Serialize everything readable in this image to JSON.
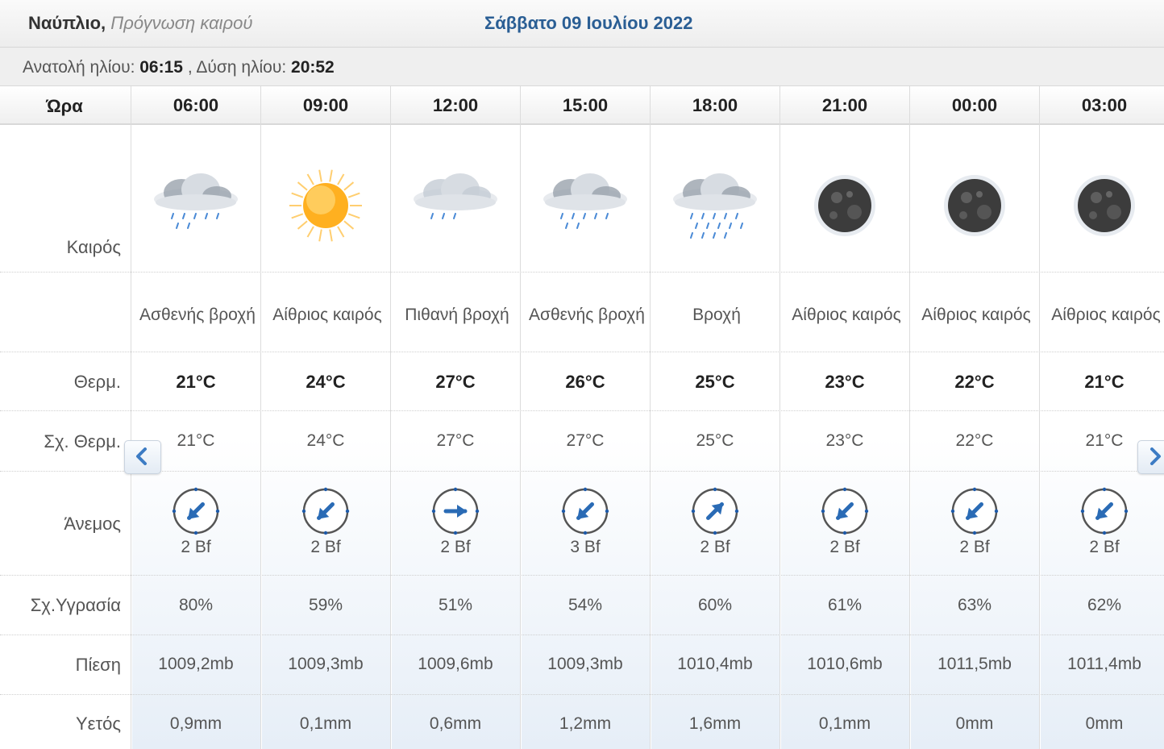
{
  "header": {
    "city": "Ναύπλιο,",
    "subtitle": "Πρόγνωση καιρού",
    "date": "Σάββατο 09 Ιουλίου 2022"
  },
  "sun": {
    "sunrise_label": "Ανατολή ηλίου:",
    "sunrise": "06:15",
    "sep": ",",
    "sunset_label": "Δύση ηλίου:",
    "sunset": "20:52"
  },
  "rows": {
    "time": "Ώρα",
    "weather": "Καιρός",
    "temp": "Θερμ.",
    "feels": "Σχ. Θερμ.",
    "wind": "Άνεμος",
    "humidity": "Σχ.Υγρασία",
    "pressure": "Πίεση",
    "rain": "Υετός"
  },
  "columns": [
    {
      "time": "06:00",
      "icon": "light-rain-icon",
      "desc": "Ασθενής βροχή",
      "temp": "21°C",
      "feels": "21°C",
      "wind_bf": "2 Bf",
      "wind_dir": "nw",
      "humidity": "80%",
      "pressure": "1009,2mb",
      "rain": "0,9mm"
    },
    {
      "time": "09:00",
      "icon": "sun-icon",
      "desc": "Αίθριος καιρός",
      "temp": "24°C",
      "feels": "24°C",
      "wind_bf": "2 Bf",
      "wind_dir": "nw",
      "humidity": "59%",
      "pressure": "1009,3mb",
      "rain": "0,1mm"
    },
    {
      "time": "12:00",
      "icon": "possible-rain-icon",
      "desc": "Πιθανή βροχή",
      "temp": "27°C",
      "feels": "27°C",
      "wind_bf": "2 Bf",
      "wind_dir": "e",
      "humidity": "51%",
      "pressure": "1009,6mb",
      "rain": "0,6mm"
    },
    {
      "time": "15:00",
      "icon": "light-rain-icon",
      "desc": "Ασθενής βροχή",
      "temp": "26°C",
      "feels": "27°C",
      "wind_bf": "3 Bf",
      "wind_dir": "nw",
      "humidity": "54%",
      "pressure": "1009,3mb",
      "rain": "1,2mm"
    },
    {
      "time": "18:00",
      "icon": "rain-icon",
      "desc": "Βροχή",
      "temp": "25°C",
      "feels": "25°C",
      "wind_bf": "2 Bf",
      "wind_dir": "se",
      "humidity": "60%",
      "pressure": "1010,4mb",
      "rain": "1,6mm"
    },
    {
      "time": "21:00",
      "icon": "moon-icon",
      "desc": "Αίθριος καιρός",
      "temp": "23°C",
      "feels": "23°C",
      "wind_bf": "2 Bf",
      "wind_dir": "nw",
      "humidity": "61%",
      "pressure": "1010,6mb",
      "rain": "0,1mm"
    },
    {
      "time": "00:00",
      "icon": "moon-icon",
      "desc": "Αίθριος καιρός",
      "temp": "22°C",
      "feels": "22°C",
      "wind_bf": "2 Bf",
      "wind_dir": "nw",
      "humidity": "63%",
      "pressure": "1011,5mb",
      "rain": "0mm"
    },
    {
      "time": "03:00",
      "icon": "moon-icon",
      "desc": "Αίθριος καιρός",
      "temp": "21°C",
      "feels": "21°C",
      "wind_bf": "2 Bf",
      "wind_dir": "nw",
      "humidity": "62%",
      "pressure": "1011,4mb",
      "rain": "0mm"
    }
  ],
  "colors": {
    "date": "#2a5e94",
    "wind_arrow": "#2a6bb5"
  }
}
